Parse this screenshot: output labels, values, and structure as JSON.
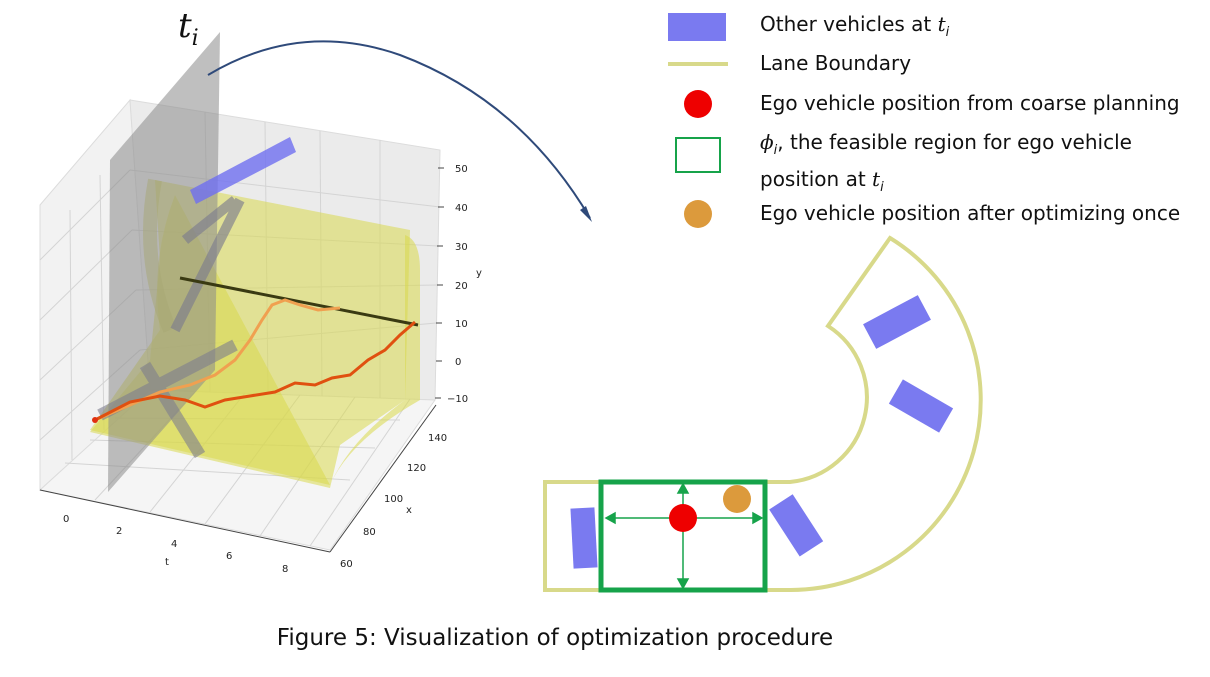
{
  "figure": {
    "caption": "Figure 5: Visualization of optimization procedure",
    "time_label": "t",
    "time_label_sub": "i"
  },
  "legend": {
    "items": [
      {
        "prefix": "",
        "math": "Other vehicles at ",
        "math_var": "t",
        "math_sub": "i",
        "text": ""
      },
      {
        "text": "Lane Boundary"
      },
      {
        "text": "Ego vehicle position from coarse planning"
      },
      {
        "math_var": "ϕ",
        "math_sub": "i",
        "text": ", the feasible region for ego vehicle",
        "text2": "position at ",
        "text2_var": "t",
        "text2_sub": "i"
      },
      {
        "text": "Ego vehicle position after optimizing once"
      }
    ]
  },
  "plot3d": {
    "t_ticks": [
      "0",
      "2",
      "4",
      "6",
      "8"
    ],
    "t_label": "t",
    "x_ticks": [
      "60",
      "80",
      "100",
      "120",
      "140"
    ],
    "x_label": "x",
    "y_ticks": [
      "−10",
      "0",
      "10",
      "20",
      "30",
      "40",
      "50"
    ],
    "y_label": "y"
  },
  "colors": {
    "vehicle": "#7a7af0",
    "lane": "#d8d98a",
    "ego_coarse": "#ee0000",
    "feasible_region": "#16a34a",
    "ego_optimized": "#dc9a3c",
    "arrow": "#2f4a7a"
  }
}
